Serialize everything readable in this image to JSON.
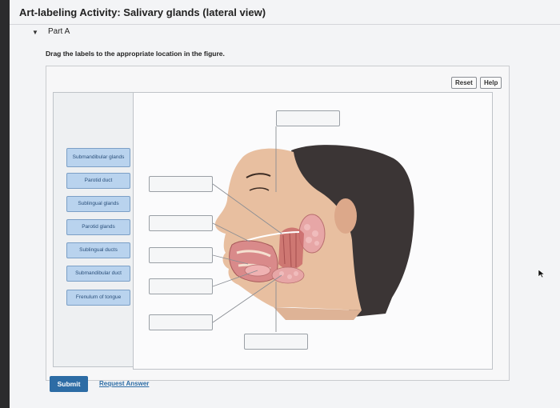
{
  "header": {
    "title_prefix": "Art-labeling Activity:",
    "title_rest": "Salivary glands (lateral view)"
  },
  "part": {
    "label": "Part A",
    "toggle_icon": "collapse-triangle-icon"
  },
  "instruction": "Drag the labels to the appropriate location in the figure.",
  "toolbar": {
    "reset_label": "Reset",
    "help_label": "Help"
  },
  "labels": [
    "Submandibular glands",
    "Parotid duct",
    "Sublingual glands",
    "Parotid glands",
    "Sublingual ducts",
    "Submandibular duct",
    "Frenulum of tongue"
  ],
  "footer": {
    "submit_label": "Submit",
    "request_label": "Request Answer"
  },
  "colors": {
    "accent": "#2d6ca5",
    "chip_fill": "#b9d3ee",
    "chip_border": "#7b9fc6",
    "gland": "#e7a6a6"
  }
}
